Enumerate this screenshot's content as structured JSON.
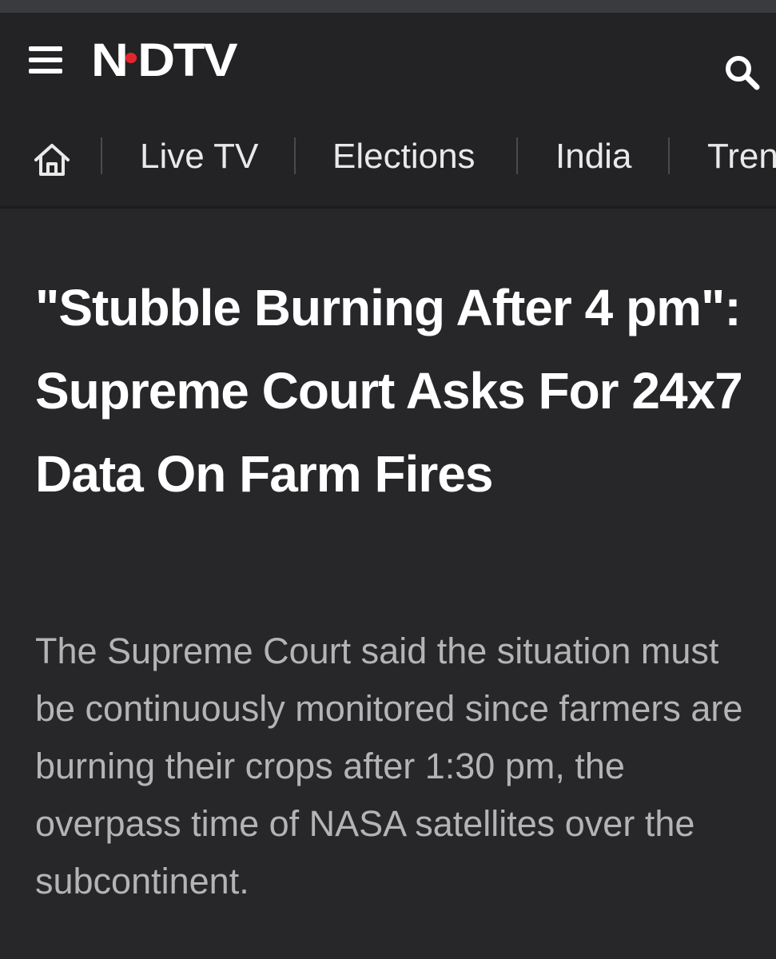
{
  "header": {
    "logo_text_left": "N",
    "logo_text_right": "DTV",
    "logo_accent_color": "#e3262e"
  },
  "nav": {
    "items": [
      {
        "label": "Live TV"
      },
      {
        "label": "Elections"
      },
      {
        "label": "India"
      },
      {
        "label": "Tren"
      }
    ]
  },
  "article": {
    "headline": "\"Stubble Burning After 4 pm\": Supreme Court Asks For 24x7 Data On Farm Fires",
    "summary": "The Supreme Court said the situation must be continuously monitored since farmers are burning their crops after 1:30 pm, the overpass time of NASA satellites over the subcontinent."
  },
  "icons": {
    "menu": "hamburger-menu-icon",
    "search": "search-icon",
    "home": "home-icon"
  }
}
